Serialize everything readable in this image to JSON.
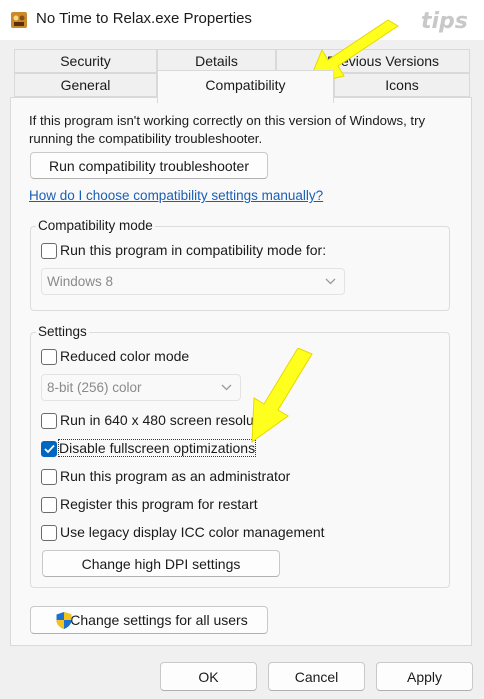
{
  "window": {
    "title": "No Time to Relax.exe Properties"
  },
  "watermark": {
    "text": "tips"
  },
  "tabs": {
    "row1": [
      "Security",
      "Details",
      "Previous Versions"
    ],
    "row2": [
      "General",
      "Compatibility",
      "Icons"
    ],
    "active": "Compatibility"
  },
  "compat": {
    "description": "If this program isn't working correctly on this version of Windows, try running the compatibility troubleshooter.",
    "troubleshooter_button": "Run compatibility troubleshooter",
    "help_link": "How do I choose compatibility settings manually?"
  },
  "compat_mode": {
    "group_label": "Compatibility mode",
    "checkbox_label": "Run this program in compatibility mode for:",
    "checked": false,
    "selected_os": "Windows 8"
  },
  "settings": {
    "group_label": "Settings",
    "reduced_color": {
      "label": "Reduced color mode",
      "checked": false
    },
    "color_select": "8-bit (256) color",
    "run_640": {
      "label": "Run in 640 x 480 screen resolution",
      "checked": false
    },
    "disable_fullscreen": {
      "label": "Disable fullscreen optimizations",
      "checked": true
    },
    "run_admin": {
      "label": "Run this program as an administrator",
      "checked": false
    },
    "register_restart": {
      "label": "Register this program for restart",
      "checked": false
    },
    "legacy_icc": {
      "label": "Use legacy display ICC color management",
      "checked": false
    },
    "dpi_button": "Change high DPI settings"
  },
  "all_users_button": "Change settings for all users",
  "footer": {
    "ok": "OK",
    "cancel": "Cancel",
    "apply": "Apply"
  },
  "colors": {
    "accent": "#0067c0",
    "link": "#1a5fb4",
    "arrow": "#ffff1e"
  }
}
